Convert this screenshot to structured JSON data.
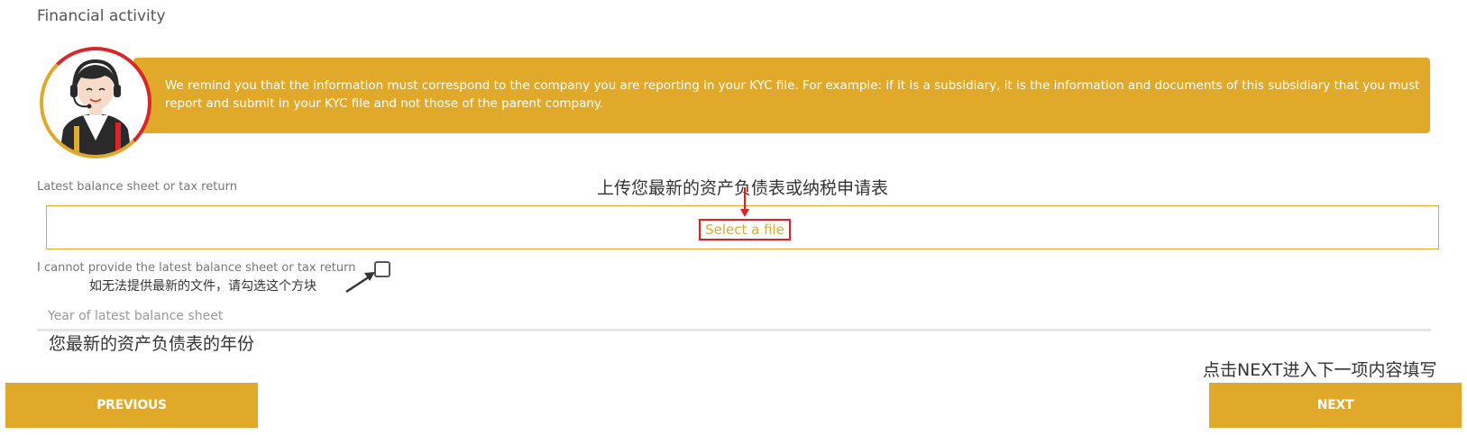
{
  "section": {
    "title": "Financial activity"
  },
  "banner": {
    "text": "We remind you that the information must correspond to the company you are reporting in your KYC file. For example: if it is a subsidiary, it is the information and documents of this subsidiary that you must report and submit in your KYC file and not those of the parent company.",
    "color": "#e1a92a",
    "avatar_icon": "support-agent-icon"
  },
  "balance_sheet": {
    "label": "Latest balance sheet or tax return",
    "upload_button": "Select a file"
  },
  "cannot_provide": {
    "label": "I cannot provide the latest balance sheet or tax return",
    "checked": false
  },
  "year_field": {
    "placeholder": "Year of latest balance sheet",
    "value": ""
  },
  "annotations": {
    "upload_hint": "上传您最新的资产负债表或纳税申请表",
    "checkbox_hint": "如无法提供最新的文件，请勾选这个方块",
    "year_hint": "您最新的资产负债表的年份",
    "next_hint": "点击NEXT进入下一项内容填写"
  },
  "nav": {
    "previous_label": "PREVIOUS",
    "next_label": "NEXT"
  },
  "colors": {
    "accent": "#e1a92a",
    "highlight": "#e02020"
  }
}
